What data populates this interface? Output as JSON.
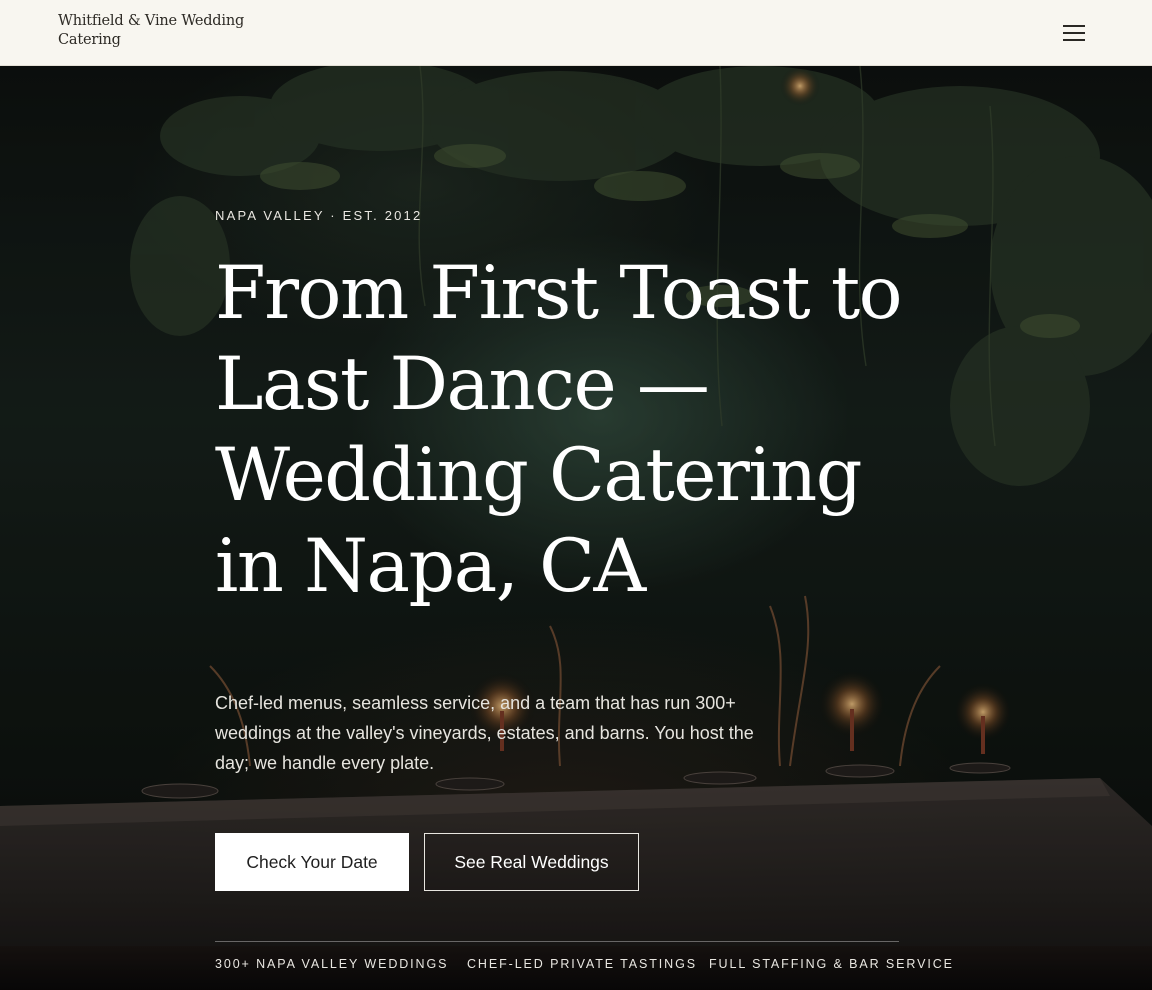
{
  "header": {
    "brand_name": "Whitfield & Vine Wedding Catering",
    "menu_icon": "hamburger-menu-icon"
  },
  "hero": {
    "eyebrow": "NAPA VALLEY · EST. 2012",
    "headline": "From First Toast to Last Dance — Wedding Catering in Napa, CA",
    "subcopy": "Chef-led menus, seamless service, and a team that has run 300+ weddings at the valley's vineyards, estates, and barns. You host the day; we handle every plate.",
    "primary_cta": "Check Your Date",
    "secondary_cta": "See Real Weddings",
    "features": [
      "300+ NAPA VALLEY WEDDINGS",
      "CHEF-LED PRIVATE TASTINGS",
      "FULL STAFFING & BAR SERVICE"
    ]
  },
  "colors": {
    "header_bg": "#f8f6f0",
    "hero_dark": "#0e1210",
    "accent_white": "#ffffff"
  }
}
